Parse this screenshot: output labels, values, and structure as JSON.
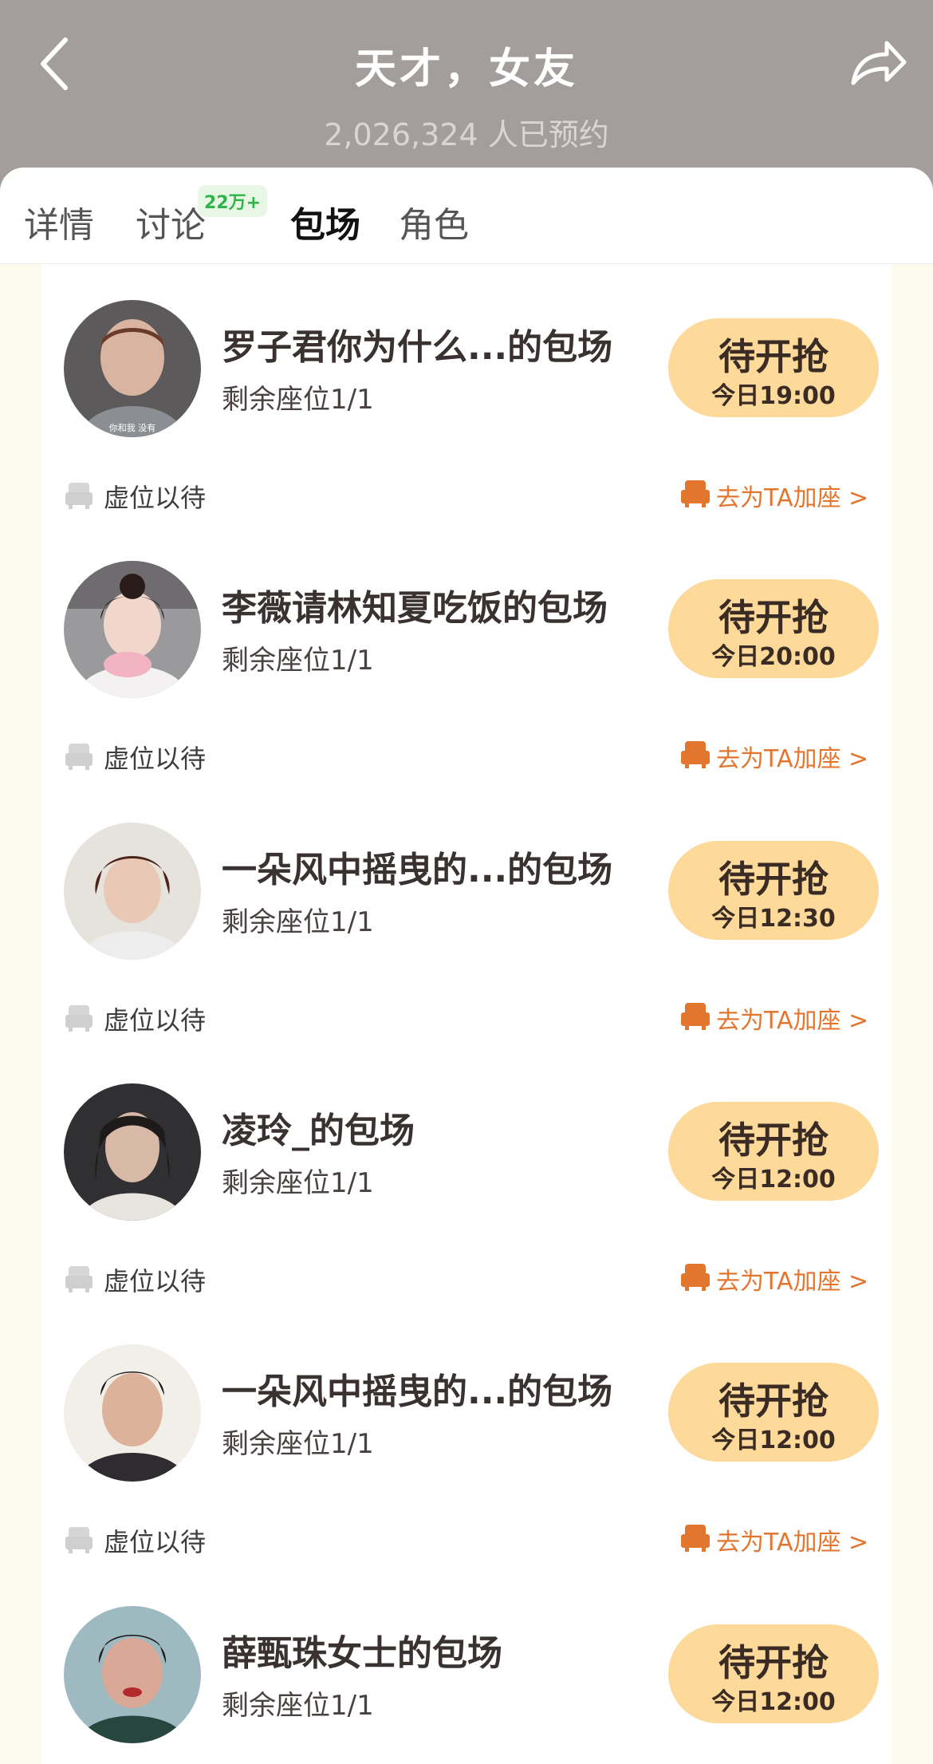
{
  "header": {
    "title": "天才，女友",
    "subtitle": "2,026,324 人已预约"
  },
  "tabs": [
    {
      "label": "详情",
      "active": false
    },
    {
      "label": "讨论",
      "active": false,
      "badge": "22万+"
    },
    {
      "label": "包场",
      "active": true
    },
    {
      "label": "角色",
      "active": false
    }
  ],
  "colors": {
    "header_bg": "#a39e9b",
    "page_bg": "#fdfbee",
    "button_bg": "#fdd99a",
    "accent_orange": "#e2762f",
    "badge_green": "#2fb34a"
  },
  "common": {
    "seats": "剩余座位1/1",
    "button_label": "待开抢",
    "vacant_text": "虚位以待",
    "add_seat_text": "去为TA加座 >"
  },
  "sessions": [
    {
      "title": "罗子君你为什么...的包场",
      "time": "今日19:00",
      "avatar_caption": "你和我 没有"
    },
    {
      "title": "李薇请林知夏吃饭的包场",
      "time": "今日20:00"
    },
    {
      "title": "一朵风中摇曳的...的包场",
      "time": "今日12:30"
    },
    {
      "title": "凌玲_的包场",
      "time": "今日12:00"
    },
    {
      "title": "一朵风中摇曳的...的包场",
      "time": "今日12:00"
    },
    {
      "title": "薛甄珠女士的包场",
      "time": "今日12:00"
    }
  ]
}
